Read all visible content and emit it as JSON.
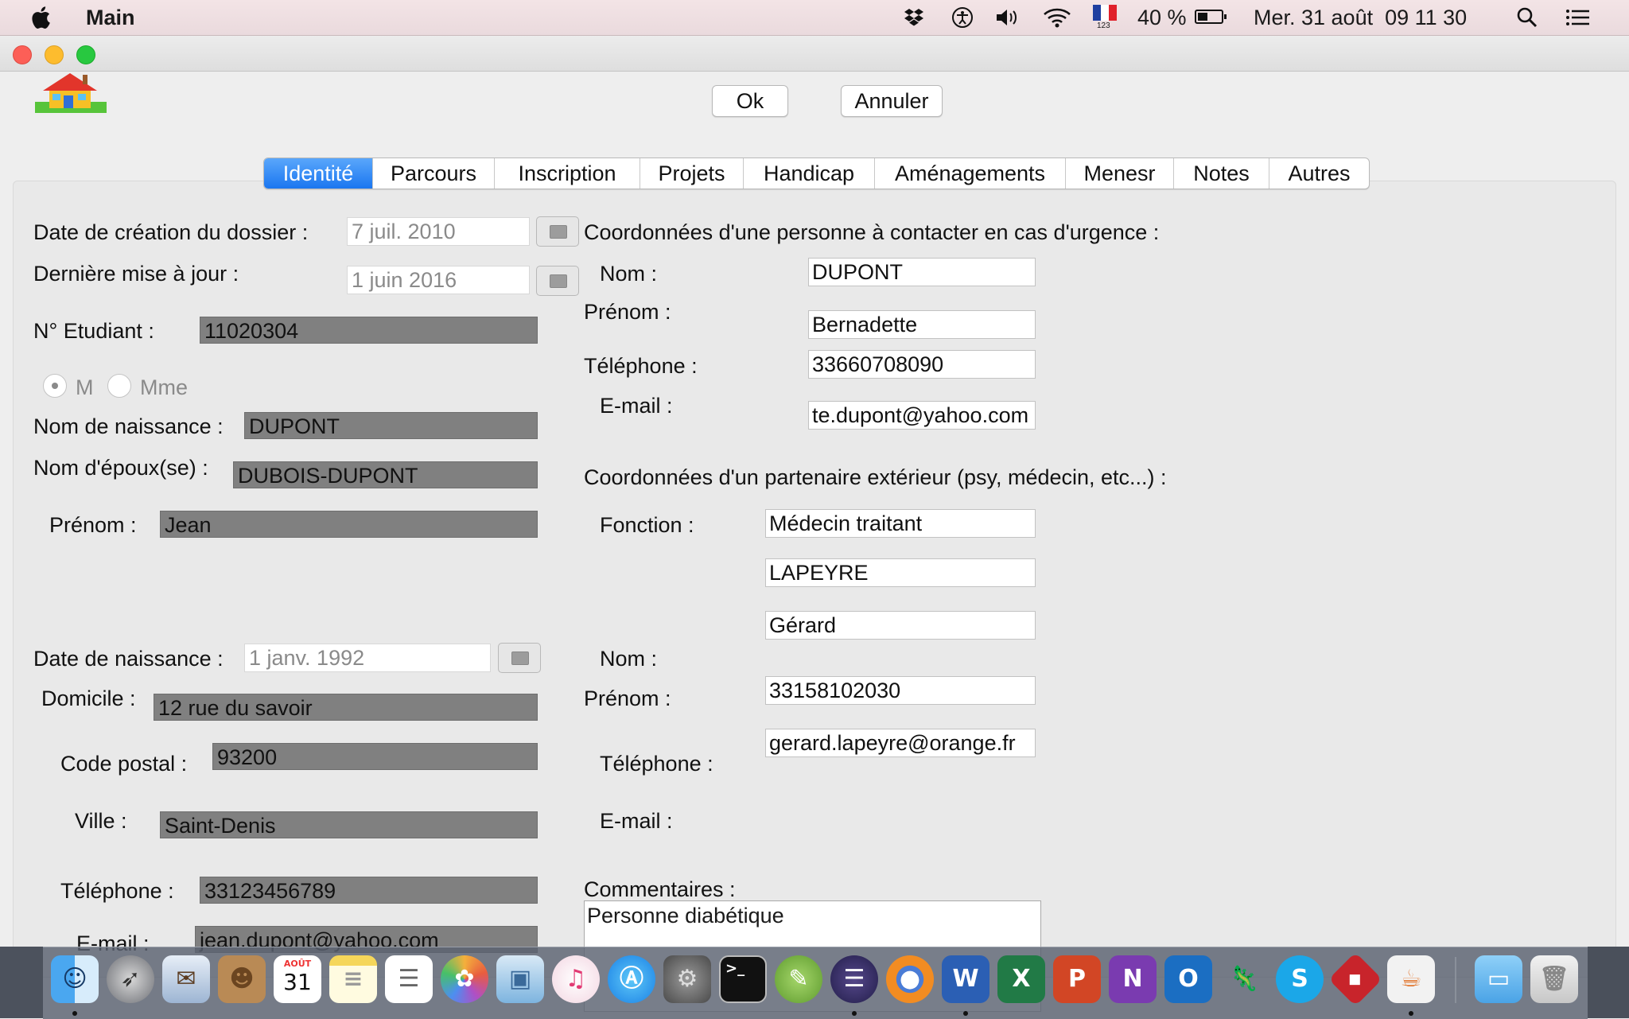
{
  "menubar": {
    "app_name": "Main",
    "battery": "40 %",
    "keyboard_layout_sub": "123",
    "datetime": "Mer. 31 août  09 11 30"
  },
  "toolbar": {
    "ok_label": "Ok",
    "cancel_label": "Annuler"
  },
  "tabs": [
    {
      "label": "Identité",
      "active": true
    },
    {
      "label": "Parcours",
      "active": false
    },
    {
      "label": "Inscription",
      "active": false
    },
    {
      "label": "Projets",
      "active": false
    },
    {
      "label": "Handicap",
      "active": false
    },
    {
      "label": "Aménagements",
      "active": false
    },
    {
      "label": "Menesr",
      "active": false
    },
    {
      "label": "Notes",
      "active": false
    },
    {
      "label": "Autres",
      "active": false
    }
  ],
  "identity": {
    "creation_date_label": "Date de création du dossier :",
    "creation_date": "7 juil. 2010",
    "last_update_label": "Dernière mise à jour :",
    "last_update": "1 juin 2016",
    "student_no_label": "N° Etudiant :",
    "student_no": "11020304",
    "gender_m": "M",
    "gender_mme": "Mme",
    "gender_selected": "M",
    "birth_name_label": "Nom de naissance :",
    "birth_name": "DUPONT",
    "spouse_name_label": "Nom d'époux(se) :",
    "spouse_name": "DUBOIS-DUPONT",
    "first_name_label": "Prénom :",
    "first_name": "Jean",
    "birth_date_label": "Date de naissance :",
    "birth_date": "1 janv. 1992",
    "address_label": "Domicile :",
    "address": "12 rue du savoir",
    "postal_code_label": "Code postal :",
    "postal_code": "93200",
    "city_label": "Ville :",
    "city": "Saint-Denis",
    "phone_label": "Téléphone :",
    "phone": "33123456789",
    "email_label": "E-mail :",
    "email": "jean.dupont@yahoo.com"
  },
  "emergency": {
    "heading": "Coordonnées d'une personne à contacter en cas d'urgence :",
    "last_name_label": "Nom :",
    "last_name": "DUPONT",
    "first_name_label": "Prénom :",
    "first_name": "Bernadette",
    "phone_label": "Téléphone :",
    "phone": "33660708090",
    "email_label": "E-mail :",
    "email": "te.dupont@yahoo.com"
  },
  "partner": {
    "heading": "Coordonnées d'un partenaire extérieur (psy, médecin, etc...) :",
    "function_label": "Fonction :",
    "function": "Médecin traitant",
    "last_name_label": "Nom :",
    "last_name": "LAPEYRE",
    "first_name_label": "Prénom :",
    "first_name": "Gérard",
    "phone_label": "Téléphone :",
    "phone": "33158102030",
    "email_label": "E-mail :",
    "email": "gerard.lapeyre@orange.fr"
  },
  "comments": {
    "label": "Commentaires :",
    "text": "Personne diabétique"
  },
  "dock": {
    "calendar_month": "AOÛT",
    "calendar_day": "31",
    "items": [
      "finder-icon",
      "launchpad-icon",
      "mail-icon",
      "contacts-icon",
      "calendar-icon",
      "notes-icon",
      "reminders-icon",
      "photos-icon",
      "preview-icon",
      "itunes-icon",
      "app-store-icon",
      "system-preferences-icon",
      "terminal-icon",
      "android-studio-icon",
      "eclipse-icon",
      "firefox-icon",
      "word-icon",
      "excel-icon",
      "powerpoint-icon",
      "onenote-icon",
      "outlook-icon",
      "chameleon-icon",
      "skype-icon",
      "filezilla-icon",
      "java-icon",
      "downloads-folder-icon",
      "trash-icon"
    ]
  },
  "colors": {
    "accent": "#1a76f0",
    "readonly_field": "#808080",
    "window_bg": "#eeeeee"
  }
}
